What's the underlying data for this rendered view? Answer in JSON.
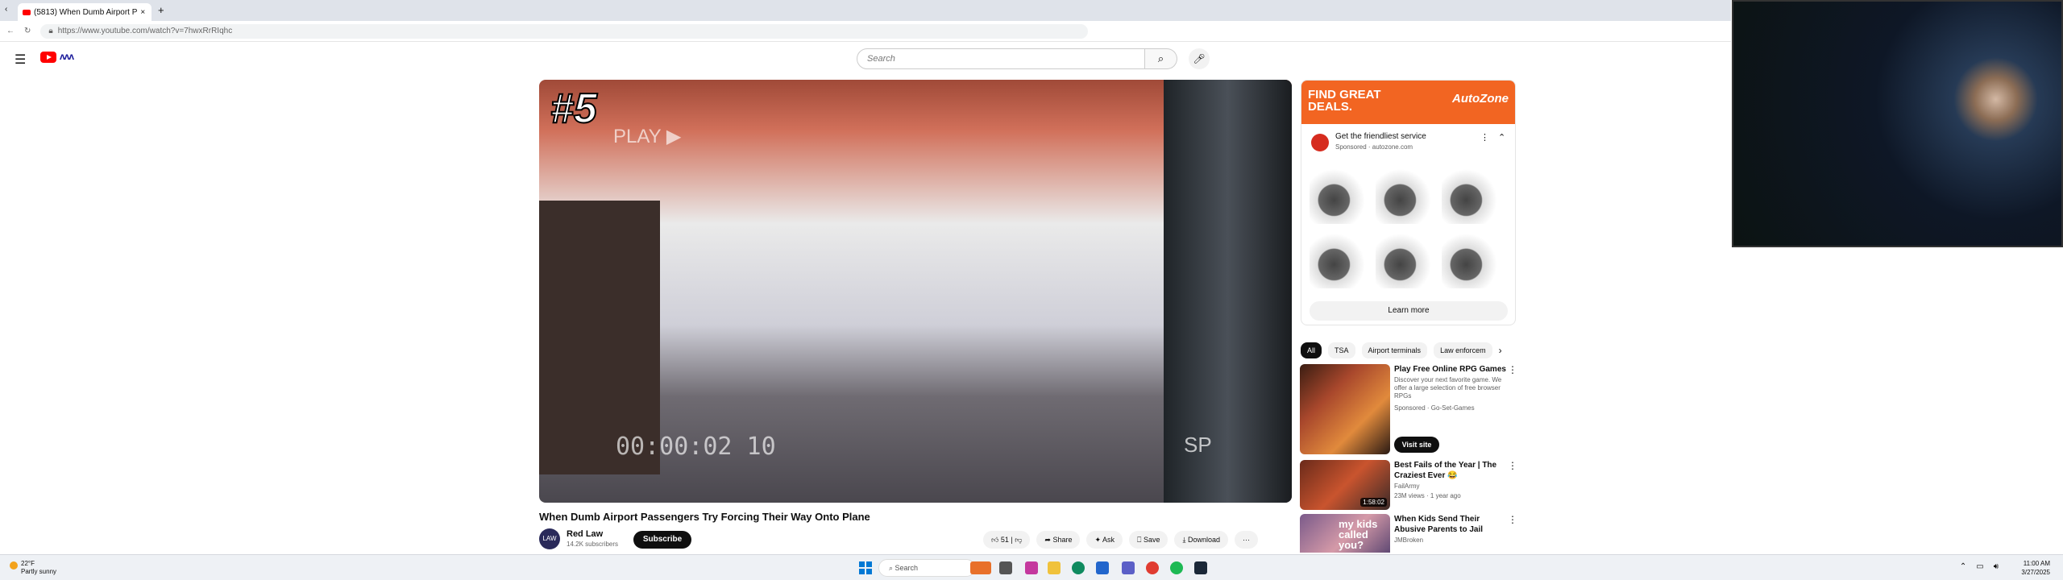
{
  "browser": {
    "tab_title": "(5813) When Dumb Airport P",
    "new_tab": "+",
    "url": "https://www.youtube.com/watch?v=7hwxRrRIqhc"
  },
  "header": {
    "search_placeholder": "Search"
  },
  "video": {
    "overlay_rank": "#5",
    "overlay_play": "PLAY ▶",
    "overlay_timecode": "00:00:02 10",
    "overlay_sp": "SP",
    "title": "When Dumb Airport Passengers Try Forcing Their Way Onto Plane",
    "channel": "Red Law",
    "subscribers": "14.2K subscribers",
    "subscribe": "Subscribe",
    "likes": "51",
    "share": "Share",
    "ask": "Ask",
    "save": "Save",
    "download": "Download",
    "more": "···"
  },
  "ad": {
    "banner": "FIND GREAT DEALS.",
    "brand": "AutoZone",
    "headline": "Get the friendliest service",
    "sponsor": "Sponsored · autozone.com",
    "cta": "Learn more"
  },
  "chips": [
    "All",
    "TSA",
    "Airport terminals",
    "Law enforcem"
  ],
  "recommendations": [
    {
      "title": "Play Free Online RPG Games",
      "desc": "Discover your next favorite game. We offer a large selection of free browser RPGs",
      "meta": "Sponsored · Go-Set-Games",
      "button": "Visit site"
    },
    {
      "title": "Best Fails of the Year | The Craziest Ever 😂",
      "channel": "FailArmy",
      "meta": "23M views · 1 year ago",
      "duration": "1:58:02"
    },
    {
      "title": "When Kids Send Their Abusive Parents to Jail",
      "channel": "JMBroken",
      "overlay": "my kids called you?"
    }
  ],
  "taskbar": {
    "weather_temp": "22°F",
    "weather_desc": "Partly sunny",
    "search": "Search",
    "time": "11:00 AM",
    "date": "3/27/2025"
  }
}
